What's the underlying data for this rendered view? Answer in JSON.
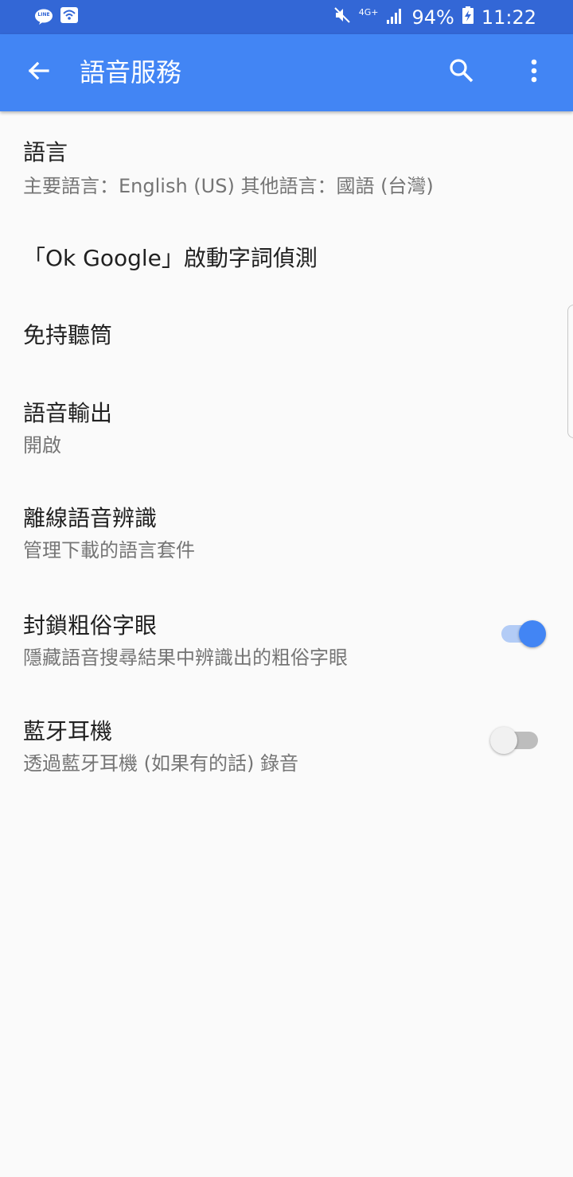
{
  "status_bar": {
    "left_icons": [
      "line-app-icon",
      "wifi-notification-icon"
    ],
    "line_badge": "LINE",
    "network": "4G+",
    "battery": "94%",
    "time": "11:22",
    "right_icons": [
      "mute-icon",
      "signal-icon",
      "battery-charging-icon"
    ]
  },
  "toolbar": {
    "title": "語音服務",
    "icons": [
      "back-arrow-icon",
      "search-icon",
      "more-vert-icon"
    ],
    "color": "#4285f4"
  },
  "settings": [
    {
      "title": "語言",
      "subtitle": "主要語言：English (US) 其他語言：國語 (台灣)"
    },
    {
      "title": "「Ok Google」啟動字詞偵測"
    },
    {
      "title": "免持聽筒"
    },
    {
      "title": "語音輸出",
      "subtitle": "開啟"
    },
    {
      "title": "離線語音辨識",
      "subtitle": "管理下載的語言套件"
    },
    {
      "title": "封鎖粗俗字眼",
      "subtitle": "隱藏語音搜尋結果中辨識出的粗俗字眼",
      "toggle": true
    },
    {
      "title": "藍牙耳機",
      "subtitle": "透過藍牙耳機 (如果有的話) 錄音",
      "toggle": false
    }
  ],
  "colors": {
    "status_bar": "#3367d6",
    "accent": "#4285f4",
    "toggle_on_track": "#b3ccf6",
    "toggle_off_track": "#bdbdbd",
    "toggle_off_thumb": "#f1f1f1"
  }
}
